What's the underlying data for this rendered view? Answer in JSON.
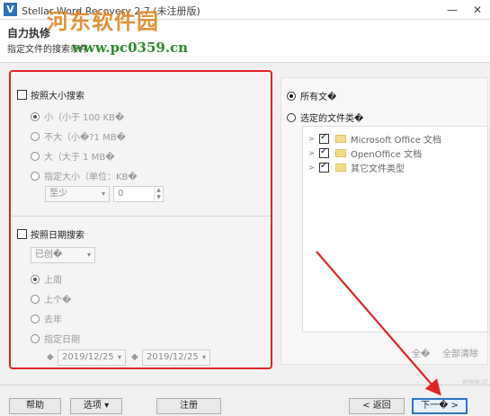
{
  "window": {
    "title": "Stellar Word Recovery 2.7 (未注册版)",
    "minimize_icon": "minimize-icon",
    "close_icon": "close-icon"
  },
  "header": {
    "title": "自力执修",
    "subtitle": "指定文件的搜索条件"
  },
  "watermark": {
    "logo_text": "河东软件园",
    "url": "www.pc0359.cn"
  },
  "left": {
    "size_search": {
      "label": "按照大小搜索",
      "checked": false,
      "options": [
        {
          "label": "小（小于 100 KB�",
          "selected": true
        },
        {
          "label": "不大（小�?1 MB�",
          "selected": false
        },
        {
          "label": "大（大于 1 MB�",
          "selected": false
        },
        {
          "label": "指定大小（单位：KB�",
          "selected": false
        }
      ],
      "comparator_value": "至少",
      "size_value": "0"
    },
    "date_search": {
      "label": "按照日期搜索",
      "checked": false,
      "dropdown_value": "已创�",
      "options": [
        {
          "label": "上周",
          "selected": true
        },
        {
          "label": "上个�",
          "selected": false
        },
        {
          "label": "去年",
          "selected": false
        },
        {
          "label": "指定日期",
          "selected": false
        }
      ],
      "from_date": "2019/12/25",
      "to_date": "2019/12/25"
    }
  },
  "right": {
    "all_files_label": "所有文�",
    "selected_types_label": "选定的文件类�",
    "file_types": [
      {
        "label": "Microsoft Office 文档",
        "checked": true
      },
      {
        "label": "OpenOffice 文档",
        "checked": true
      },
      {
        "label": "其它文件类型",
        "checked": true
      }
    ],
    "select_all_label": "全�",
    "clear_all_label": "全部清除"
  },
  "footer": {
    "help_label": "帮助",
    "options_label": "选项 ▾",
    "register_label": "注册",
    "back_label": "< 返回",
    "next_label": "下一� >",
    "faded_url": "www.st"
  },
  "colors": {
    "highlight_border": "#e02424",
    "primary_button_border": "#2c74c8",
    "watermark_logo": "#e0892a",
    "watermark_url": "#2f8a2f"
  }
}
